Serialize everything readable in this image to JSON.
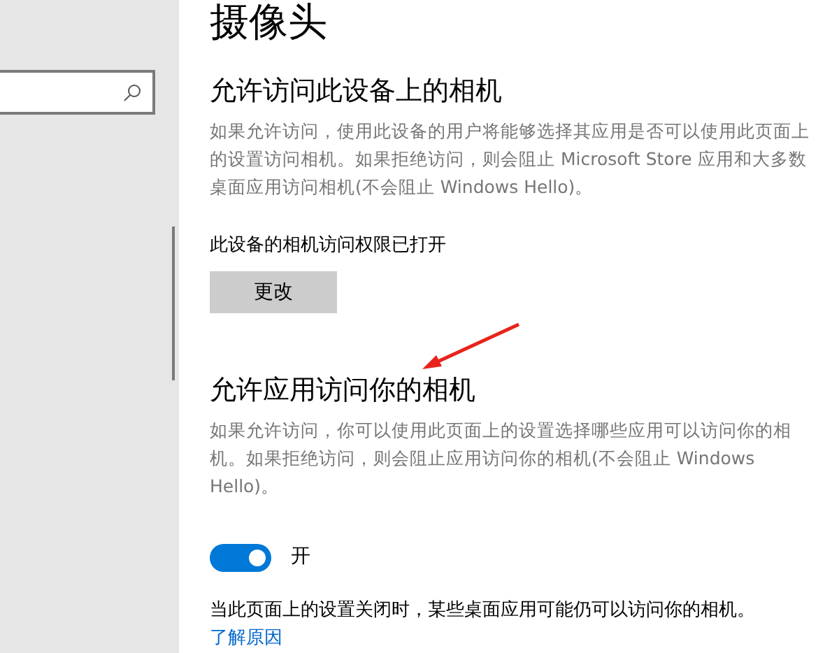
{
  "page_title": "摄像头",
  "device_section": {
    "heading": "允许访问此设备上的相机",
    "description": "如果允许访问，使用此设备的用户将能够选择其应用是否可以使用此页面上的设置访问相机。如果拒绝访问，则会阻止 Microsoft Store 应用和大多数桌面应用访问相机(不会阻止 Windows Hello)。",
    "status": "此设备的相机访问权限已打开",
    "button": "更改"
  },
  "apps_section": {
    "heading": "允许应用访问你的相机",
    "description": "如果允许访问，你可以使用此页面上的设置选择哪些应用可以访问你的相机。如果拒绝访问，则会阻止应用访问你的相机(不会阻止 Windows Hello)。",
    "toggle": {
      "on": true,
      "label": "开"
    }
  },
  "note": {
    "text": "当此页面上的设置关闭时，某些桌面应用可能仍可以访问你的相机。",
    "link": "了解原因"
  }
}
